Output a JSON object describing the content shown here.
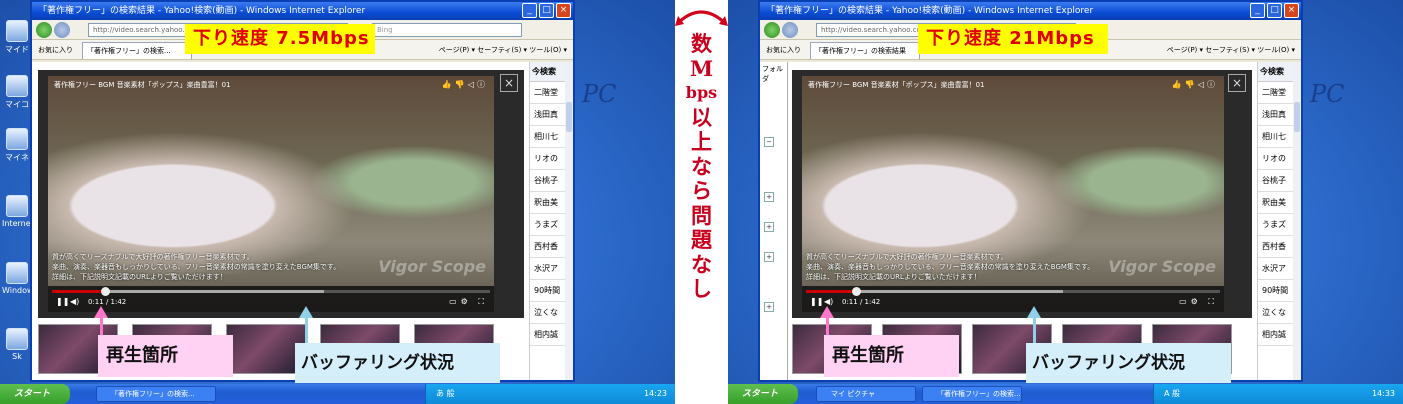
{
  "left": {
    "ie_title": "「著作権フリー」の検索結果 - Yahoo!検索(動画) - Windows Internet Explorer",
    "url": "http://video.search.yahoo.co",
    "search_hint": "Bing",
    "favorites": "お気に入り",
    "tab_label": "「著作権フリー」の検索...",
    "menu": "ページ(P) ▾  セーフティ(S) ▾  ツール(O) ▾",
    "speed_label": "下り速度 7.5Mbps",
    "player_title": "著作権フリー BGM 音楽素材「ポップス」楽曲豊富！01",
    "desc_lines": [
      "質が高くてリーズナブルで大好評の著作権フリー音楽素材です。",
      "楽曲、演奏、楽器音もしっかりしている、フリー音楽素材の常識を塗り変えたBGM集です。",
      "詳細は、下記説明文記載のURLよりご覧いただけます！"
    ],
    "watermark": "Vigor Scope",
    "time": "0:11 / 1:42",
    "sidebar_header": "今検索",
    "sidebar_items": [
      "二階堂",
      "浅田真",
      "相川七",
      "リオの",
      "谷桃子",
      "釈由美",
      "うまズ",
      "西村香",
      "水沢ア",
      "90時間",
      "泣くな",
      "相内誠"
    ],
    "play_pos": 0.12,
    "buffer_pos": 0.62,
    "played_label": "再生箇所",
    "buffer_label": "バッファリング状況",
    "taskbar_item": "「著作権フリー」の検索...",
    "start_label": "スタート",
    "ime_text": "あ 般",
    "clock": "14:23",
    "desk_labels": [
      "マイド",
      "マイコ",
      "マイネ",
      "Internet",
      "Windows",
      "Sk"
    ],
    "pc_text": "PC"
  },
  "middle": {
    "chars": [
      "数",
      "M",
      "bps",
      "以",
      "上",
      "な",
      "ら",
      "問",
      "題",
      "な",
      "し"
    ],
    "arrow_color": "#d3001a"
  },
  "right": {
    "ie_title": "「著作権フリー」の検索結果 - Yahoo!検索(動画) - Windows Internet Explorer",
    "url": "http://video.search.yahoo.co",
    "favorites": "お気に入り",
    "tab_label": "「著作権フリー」の検索結果",
    "menu": "ページ(P) ▾  セーフティ(S) ▾  ツール(O) ▾",
    "speed_label": "下り速度 21Mbps",
    "player_title": "著作権フリー BGM 音楽素材「ポップス」楽曲豊富！01",
    "desc_lines": [
      "質が高くてリーズナブルで大好評の著作権フリー音楽素材です。",
      "楽曲、演奏、楽器音もしっかりしている、フリー音楽素材の常識を塗り変えたBGM集です。",
      "詳細は、下記説明文記載のURLよりご覧いただけます！"
    ],
    "watermark": "Vigor Scope",
    "time": "0:11 / 1:42",
    "sidebar_header": "今検索",
    "sidebar_items": [
      "二階堂",
      "浅田真",
      "相川七",
      "リオの",
      "谷桃子",
      "釈由美",
      "うまズ",
      "西村香",
      "水沢ア",
      "90時間",
      "泣くな",
      "相内誠"
    ],
    "play_pos": 0.12,
    "buffer_pos": 0.62,
    "played_label": "再生箇所",
    "buffer_label": "バッファリング状況",
    "taskbar_items": [
      "マイ ピクチャ",
      "「著作権フリー」の検索..."
    ],
    "start_label": "スタート",
    "ime_text": "A 般",
    "clock": "14:33",
    "folder_label": "フォルダ",
    "pc_text": "PC"
  },
  "colors": {
    "speed_bg": "#ffff00",
    "speed_text": "#e00000",
    "pink_label": "#ffd1f2",
    "blue_label": "#d4eefa",
    "pink_arrow": "#ff77c8",
    "blue_arrow": "#8fd0e8"
  }
}
